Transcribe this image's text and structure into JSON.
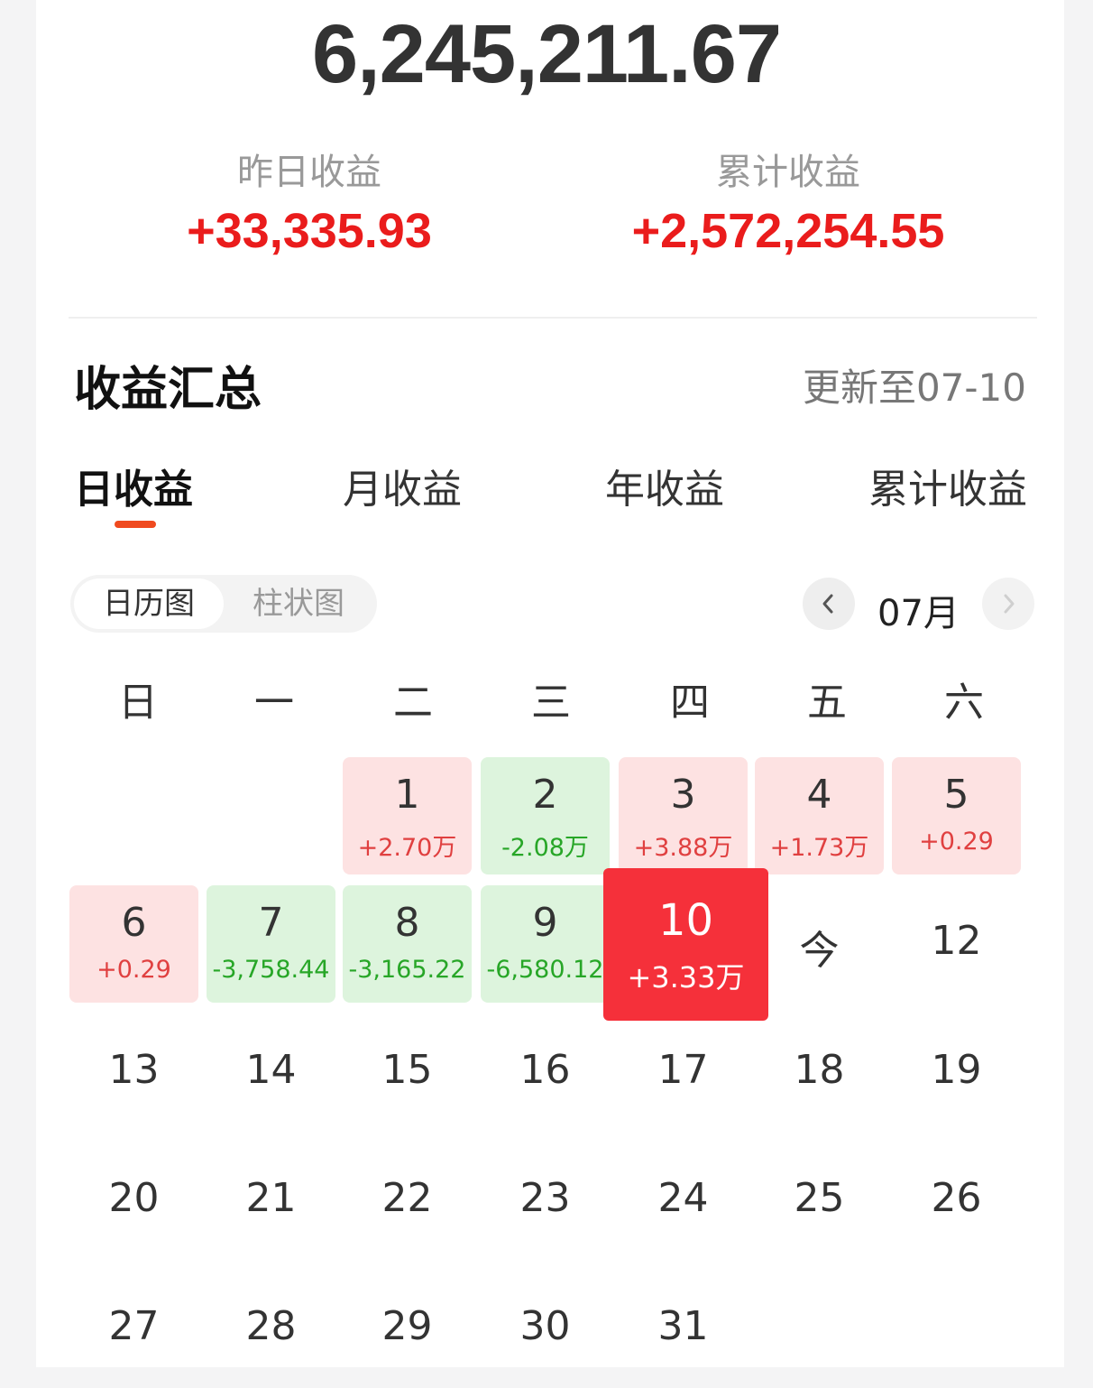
{
  "summary": {
    "total": "6,245,211.67",
    "yesterday_label": "昨日收益",
    "yesterday_value": "+33,335.93",
    "cumulative_label": "累计收益",
    "cumulative_value": "+2,572,254.55"
  },
  "section": {
    "title": "收益汇总",
    "update_text": "更新至07-10"
  },
  "tabs": [
    {
      "label": "日收益",
      "active": true
    },
    {
      "label": "月收益",
      "active": false
    },
    {
      "label": "年收益",
      "active": false
    },
    {
      "label": "累计收益",
      "active": false
    }
  ],
  "view_toggle": {
    "calendar": "日历图",
    "bar": "柱状图"
  },
  "month": {
    "label": "07月"
  },
  "weekdays": [
    "日",
    "一",
    "二",
    "三",
    "四",
    "五",
    "六"
  ],
  "calendar": [
    {
      "day": "1",
      "amount": "+2.70万",
      "status": "pos"
    },
    {
      "day": "2",
      "amount": "-2.08万",
      "status": "neg"
    },
    {
      "day": "3",
      "amount": "+3.88万",
      "status": "pos"
    },
    {
      "day": "4",
      "amount": "+1.73万",
      "status": "pos"
    },
    {
      "day": "5",
      "amount": "+0.29",
      "status": "pos"
    },
    {
      "day": "6",
      "amount": "+0.29",
      "status": "pos"
    },
    {
      "day": "7",
      "amount": "-3,758.44",
      "status": "neg"
    },
    {
      "day": "8",
      "amount": "-3,165.22",
      "status": "neg"
    },
    {
      "day": "9",
      "amount": "-6,580.12",
      "status": "neg"
    },
    {
      "day": "10",
      "amount": "+3.33万",
      "status": "selected"
    },
    {
      "day": "今",
      "amount": "",
      "status": "plain"
    },
    {
      "day": "12",
      "amount": "",
      "status": "plain"
    },
    {
      "day": "13",
      "amount": "",
      "status": "plain"
    },
    {
      "day": "14",
      "amount": "",
      "status": "plain"
    },
    {
      "day": "15",
      "amount": "",
      "status": "plain"
    },
    {
      "day": "16",
      "amount": "",
      "status": "plain"
    },
    {
      "day": "17",
      "amount": "",
      "status": "plain"
    },
    {
      "day": "18",
      "amount": "",
      "status": "plain"
    },
    {
      "day": "19",
      "amount": "",
      "status": "plain"
    },
    {
      "day": "20",
      "amount": "",
      "status": "plain"
    },
    {
      "day": "21",
      "amount": "",
      "status": "plain"
    },
    {
      "day": "22",
      "amount": "",
      "status": "plain"
    },
    {
      "day": "23",
      "amount": "",
      "status": "plain"
    },
    {
      "day": "24",
      "amount": "",
      "status": "plain"
    },
    {
      "day": "25",
      "amount": "",
      "status": "plain"
    },
    {
      "day": "26",
      "amount": "",
      "status": "plain"
    },
    {
      "day": "27",
      "amount": "",
      "status": "plain"
    },
    {
      "day": "28",
      "amount": "",
      "status": "plain"
    },
    {
      "day": "29",
      "amount": "",
      "status": "plain"
    },
    {
      "day": "30",
      "amount": "",
      "status": "plain"
    },
    {
      "day": "31",
      "amount": "",
      "status": "plain"
    }
  ],
  "colors": {
    "positive": "#e04040",
    "negative": "#27a627",
    "selected": "#f5303a",
    "accent_underline": "#f04a1f"
  },
  "icons": {
    "prev": "chevron-left-icon",
    "next": "chevron-right-icon"
  }
}
